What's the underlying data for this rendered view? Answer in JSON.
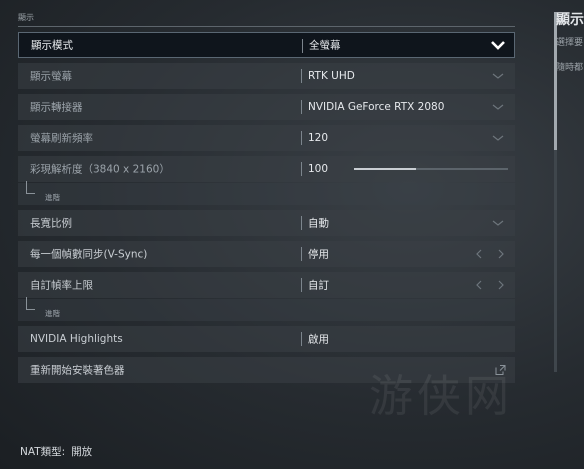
{
  "section": {
    "title": "顯示"
  },
  "rows": [
    {
      "label": "顯示模式",
      "value": "全螢幕"
    },
    {
      "label": "顯示螢幕",
      "value": "RTK UHD"
    },
    {
      "label": "顯示轉接器",
      "value": "NVIDIA GeForce RTX 2080"
    },
    {
      "label": "螢幕刷新頻率",
      "value": "120"
    },
    {
      "label": "彩現解析度（3840 x 2160）",
      "value": "100",
      "slider_fraction": 0.4
    },
    {
      "sub_label": "進階"
    },
    {
      "label": "長寬比例",
      "value": "自動"
    },
    {
      "label": "每一個幀數同步(V-Sync)",
      "value": "停用"
    },
    {
      "label": "自訂幀率上限",
      "value": "自訂"
    },
    {
      "sub_label": "進階"
    },
    {
      "label": "NVIDIA Highlights",
      "value": "啟用"
    },
    {
      "label": "重新開始安裝著色器"
    }
  ],
  "side_panel": {
    "title": "顯示",
    "line1": "選擇要",
    "line2": "隨時都"
  },
  "footer": {
    "label": "NAT類型:",
    "value": "開放"
  },
  "watermark": "游侠网",
  "colors": {
    "active_row_bg": "#0f151c",
    "row_bg": "#3a4046"
  },
  "icons": {
    "dropdown": "chevron-down-icon",
    "prev": "chevron-left-icon",
    "next": "chevron-right-icon",
    "external": "external-link-icon"
  }
}
